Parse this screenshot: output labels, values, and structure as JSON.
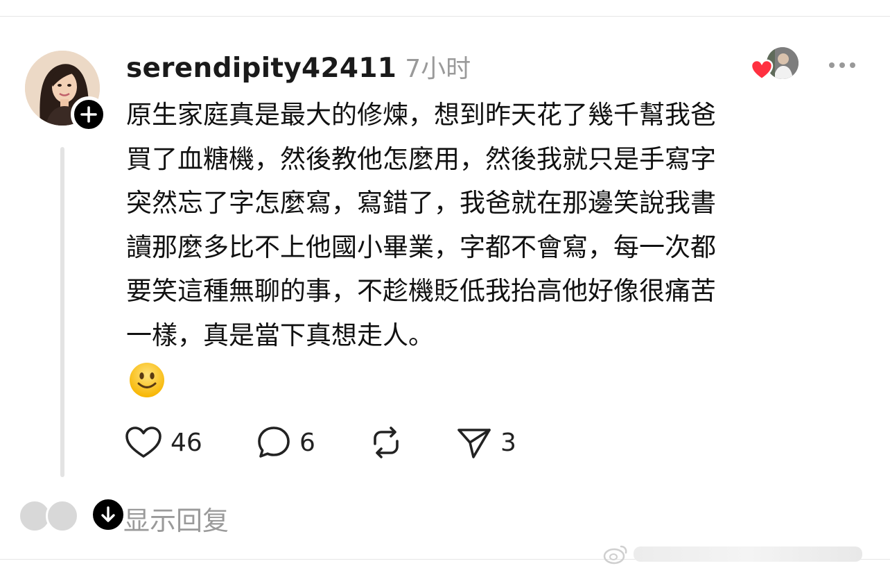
{
  "post": {
    "username": "serendipity42411",
    "timestamp": "7小时",
    "body_lines": [
      "原生家庭真是最大的修煉，想到昨天花了幾千幫我爸",
      "買了血糖機，然後教他怎麼用，然後我就只是手寫字",
      "突然忘了字怎麼寫，寫錯了，我爸就在那邊笑說我書",
      "讀那麼多比不上他國小畢業，字都不會寫，每一次都",
      "要笑這種無聊的事，不趁機貶低我抬高他好像很痛苦",
      "一樣，真是當下真想走人。"
    ],
    "emoji_icon": "slightly-smiling-face-emoji"
  },
  "actions": {
    "likes": "46",
    "comments": "6",
    "shares": "3"
  },
  "replies": {
    "label": "显示回复"
  },
  "colors": {
    "heart": "#ff3040",
    "muted_text": "#9a9a9a",
    "thread_line": "#e3e3e3"
  }
}
